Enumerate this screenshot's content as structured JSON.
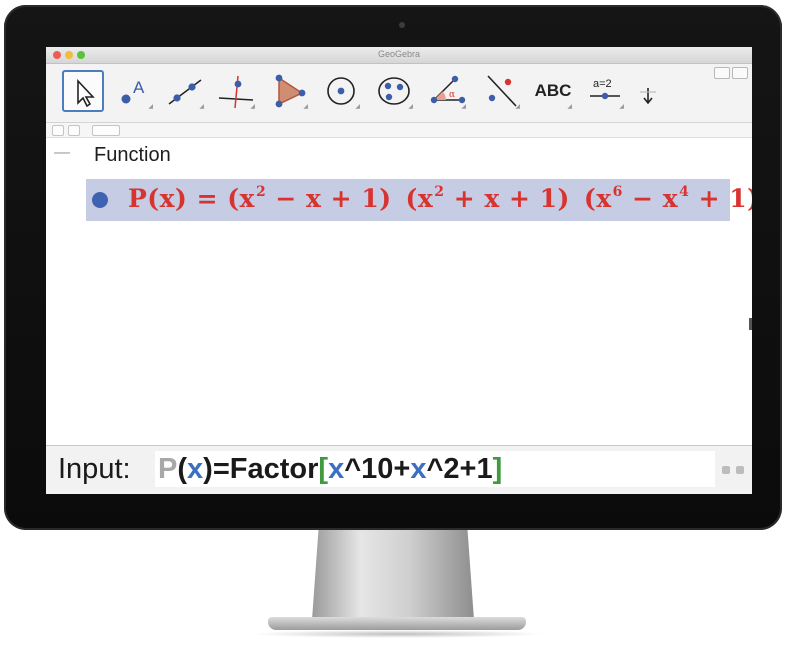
{
  "window": {
    "title": "GeoGebra"
  },
  "toolbar": {
    "tools": [
      {
        "name": "move-tool"
      },
      {
        "name": "point-tool",
        "label": "A"
      },
      {
        "name": "line-tool"
      },
      {
        "name": "perpendicular-line-tool"
      },
      {
        "name": "polygon-tool"
      },
      {
        "name": "circle-center-point-tool"
      },
      {
        "name": "conic-five-points-tool"
      },
      {
        "name": "angle-tool",
        "label": "α"
      },
      {
        "name": "reflect-about-line-tool"
      },
      {
        "name": "text-tool",
        "label": "ABC"
      },
      {
        "name": "slider-tool",
        "label": "a=2"
      },
      {
        "name": "move-graphics-view-tool"
      }
    ]
  },
  "algebra": {
    "category": "Function",
    "objects": [
      {
        "name": "P",
        "variable": "x",
        "expression": "P(x) = (x^2 − x + 1) (x^2 + x + 1) (x^6 − x^4 + 1)",
        "display": {
          "lhs": "P(x) = ",
          "f1_open": "(x",
          "f1_exp": "2",
          "f1_rest": " − x + 1)",
          "f2_open": "(x",
          "f2_exp": "2",
          "f2_rest": " + x + 1)",
          "f3_open": "(x",
          "f3_exp": "6",
          "f3_mid": " − x",
          "f3_exp2": "4",
          "f3_rest": " + 1)"
        },
        "color": "#d8332f",
        "selected": true
      }
    ]
  },
  "input_bar": {
    "label": "Input:",
    "value": "P(x)=Factor[x^10+x^2+1]",
    "tokens": {
      "fname": "P",
      "paren_open": "(",
      "var1": "x",
      "rest1": ")=Factor",
      "bracket_open": "[",
      "var2": "x",
      "rest2": "^10+",
      "var3": "x",
      "rest3": "^2+1",
      "bracket_close": "]"
    }
  },
  "colors": {
    "accent": "#4d7cc0",
    "selection": "#c5cce3",
    "function": "#d8332f",
    "variable": "#3b6fc2",
    "bracket": "#3e9b3e"
  }
}
